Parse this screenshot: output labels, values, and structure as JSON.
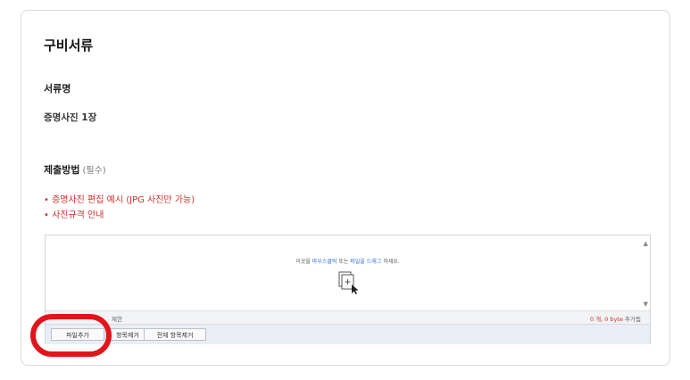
{
  "section_title": "구비서류",
  "document": {
    "label": "서류명",
    "value": "증명사진 1장"
  },
  "submission": {
    "label": "제출방법",
    "required_note": "(필수)"
  },
  "links": [
    "• 증명사진 편집 예시 (JPG 사진만 가능)",
    "• 사진규격 안내"
  ],
  "uploader": {
    "drop_text_pre": "이곳을 ",
    "drop_text_hl1": "마우스클릭",
    "drop_text_mid": " 또는 ",
    "drop_text_hl2": "파일을 드래그",
    "drop_text_post": " 하세요.",
    "limit_text": "제한",
    "count_text": "0 개, 0 byte",
    "count_suffix": " 추가됨",
    "buttons": {
      "add": "파일추가",
      "remove": "항목제거",
      "remove_all": "전체 항목제거"
    }
  },
  "colors": {
    "link_red": "#d0312d",
    "highlight_red": "#e2141b"
  },
  "icons": {
    "drop": "file-add-cursor-icon",
    "scroll_up": "triangle-up-icon",
    "scroll_down": "triangle-down-icon"
  }
}
